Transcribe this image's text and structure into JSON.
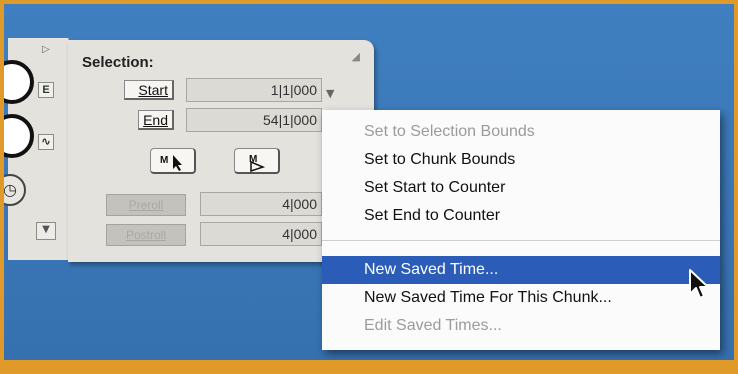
{
  "selection_window": {
    "title": "Selection:",
    "start_label": "Start",
    "end_label": "End",
    "start_value": "1|1|000",
    "end_value": "54|1|000",
    "preroll_label": "Preroll",
    "postroll_label": "Postroll",
    "preroll_value": "4|000",
    "postroll_value": "4|000"
  },
  "left_strip": {
    "button_e": "E",
    "button_wave": "∿"
  },
  "context_menu": {
    "items": [
      {
        "label": "Set to Selection Bounds",
        "enabled": false
      },
      {
        "label": "Set to Chunk  Bounds",
        "enabled": true
      },
      {
        "label": "Set Start to Counter",
        "enabled": true
      },
      {
        "label": "Set End to Counter",
        "enabled": true
      },
      {
        "label": "New Saved Time...",
        "enabled": true,
        "selected": true
      },
      {
        "label": "New Saved Time For This Chunk...",
        "enabled": true
      },
      {
        "label": "Edit Saved Times...",
        "enabled": false
      }
    ]
  },
  "colors": {
    "frame": "#e09a2a",
    "desktop": "#3a76b6",
    "highlight": "#2b5db8"
  }
}
